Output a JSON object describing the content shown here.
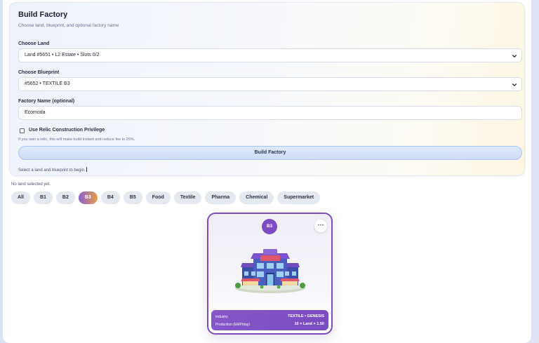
{
  "form": {
    "title": "Build Factory",
    "subtitle": "Choose land, blueprint, and optional factory name",
    "land_label": "Choose Land",
    "land_value": "Land #5651 • L2 Estate • Slots 0/2",
    "blueprint_label": "Choose Blueprint",
    "blueprint_value": "#5652 • TEXTILE B3",
    "name_label": "Factory Name (optional)",
    "name_value": "Ecomoda",
    "relic_label": "Use Relic Construction Privilege",
    "relic_checked": false,
    "relic_hint": "If you own a relic, this will make build instant and reduce fee to 25%.",
    "build_button": "Build Factory",
    "status": "Select a land and blueprint to begin."
  },
  "no_land_text": "No land selected yet.",
  "filters": {
    "active": "B3",
    "items": [
      "All",
      "B1",
      "B2",
      "B3",
      "B4",
      "B5",
      "Food",
      "Textile",
      "Pharma",
      "Chemical",
      "Supermarket"
    ]
  },
  "factory_card": {
    "badge": "B3",
    "more": "⋯",
    "industry_label": "Industry",
    "industry_value": "TEXTILE • GENESIS",
    "production_label": "Production (EMP/day)",
    "production_value": "10 × Land × 1.50"
  },
  "colors": {
    "accent": "#7d4cc2",
    "button": "#cfdcf7",
    "chip": "#e4e8ef"
  }
}
